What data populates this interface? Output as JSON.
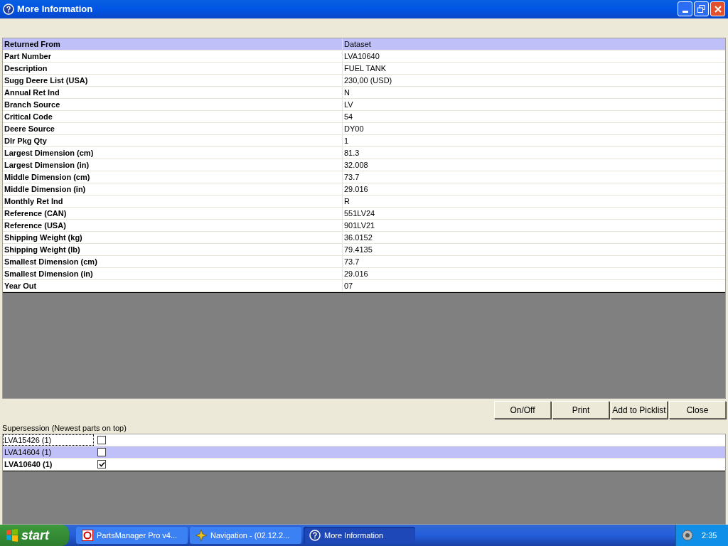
{
  "window": {
    "title": "More Information"
  },
  "table": {
    "columns": [
      "Returned From",
      "Dataset"
    ],
    "rows": [
      [
        "Part Number",
        "LVA10640"
      ],
      [
        "Description",
        "FUEL TANK"
      ],
      [
        "Sugg Deere List (USA)",
        "230,00  (USD)"
      ],
      [
        "Annual Ret Ind",
        "N"
      ],
      [
        "Branch Source",
        "LV"
      ],
      [
        "Critical Code",
        "54"
      ],
      [
        "Deere Source",
        "DY00"
      ],
      [
        "Dlr Pkg Qty",
        "1"
      ],
      [
        "Largest Dimension (cm)",
        "81.3"
      ],
      [
        "Largest Dimension (in)",
        "32.008"
      ],
      [
        "Middle Dimension (cm)",
        "73.7"
      ],
      [
        "Middle Dimension (in)",
        "29.016"
      ],
      [
        "Monthly Ret Ind",
        "R"
      ],
      [
        "Reference (CAN)",
        "551LV24"
      ],
      [
        "Reference (USA)",
        "901LV21"
      ],
      [
        "Shipping Weight (kg)",
        "36.0152"
      ],
      [
        "Shipping Weight (lb)",
        "79.4135"
      ],
      [
        "Smallest Dimension (cm)",
        "73.7"
      ],
      [
        "Smallest Dimension (in)",
        "29.016"
      ],
      [
        "Year Out",
        "07"
      ]
    ]
  },
  "buttons": [
    "On/Off",
    "Print",
    "Add to Picklist",
    "Close"
  ],
  "supersession": {
    "label": "Supersession  (Newest parts on top)",
    "items": [
      {
        "part": "LVA15426  (1)",
        "checked": false,
        "selected": false,
        "focused": true,
        "current": false
      },
      {
        "part": "LVA14604  (1)",
        "checked": false,
        "selected": true,
        "focused": false,
        "current": false
      },
      {
        "part": "LVA10640  (1)",
        "checked": true,
        "selected": false,
        "focused": false,
        "current": true
      }
    ]
  },
  "taskbar": {
    "start": "start",
    "tasks": [
      {
        "label": "PartsManager Pro v4...",
        "selected": false,
        "kind": "parts"
      },
      {
        "label": "Navigation - (02.12.2...",
        "selected": false,
        "kind": "nav"
      },
      {
        "label": "More Information",
        "selected": true,
        "kind": "help"
      }
    ],
    "clock": "2:35"
  }
}
